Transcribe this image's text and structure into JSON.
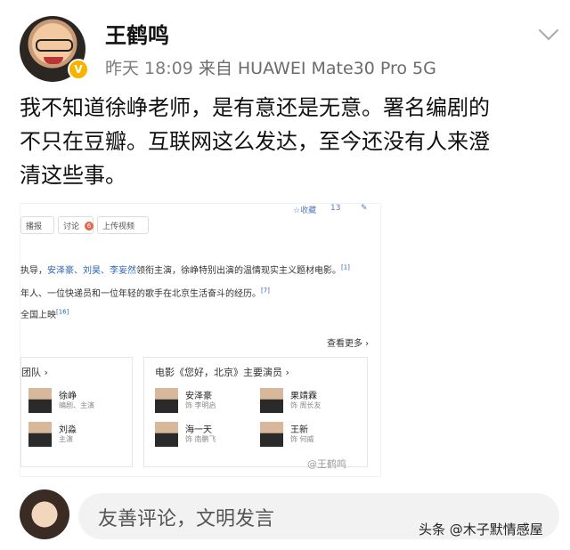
{
  "post": {
    "author": "王鹤鸣",
    "time": "昨天 18:09",
    "source": "来自 HUAWEI Mate30 Pro 5G",
    "text_lines": [
      "我不知道徐峥老师，是有意还是无意。署名编剧的",
      "不只在豆瓣。互联网这么发达，至今还没有人来澄",
      "清这些事。"
    ]
  },
  "screenshot": {
    "top_actions": [
      "☆收藏",
      "13",
      "✎"
    ],
    "tabs": [
      "播报",
      "讨论",
      "上传视频"
    ],
    "discussion_badge": "6",
    "lines": [
      {
        "pre": "执导，",
        "blue": "安泽豪、刘昊、李妄然",
        "post": "领衔主演，徐峥特别出演的温情现实主义题材电影。",
        "ref": "[1]"
      },
      {
        "pre": "年人、一位快递员和一位年轻的歌手在北京生活奋斗的经历。",
        "blue": "",
        "post": "",
        "ref": "[7]"
      },
      {
        "pre": "全国上映",
        "blue": "",
        "post": "",
        "ref": "[16]"
      }
    ],
    "more": "查看更多 ›",
    "left_panel_title": "团队 ›",
    "right_panel_title": "电影《您好，北京》主要演员 ›",
    "left_people": [
      {
        "name": "徐峥",
        "role": "编剧、主演"
      },
      {
        "name": "刘淼",
        "role": "主演"
      }
    ],
    "right_people": [
      {
        "name": "安泽豪",
        "role": "饰 李明启"
      },
      {
        "name": "果靖霖",
        "role": "饰 周长友"
      },
      {
        "name": "海一天",
        "role": "饰 南鹏飞"
      },
      {
        "name": "王新",
        "role": "饰 何威"
      }
    ],
    "watermark": "@王鹤鸣"
  },
  "comment": {
    "placeholder": "友善评论，文明发言"
  },
  "footer_watermark": "头条 @木子默情感屋"
}
